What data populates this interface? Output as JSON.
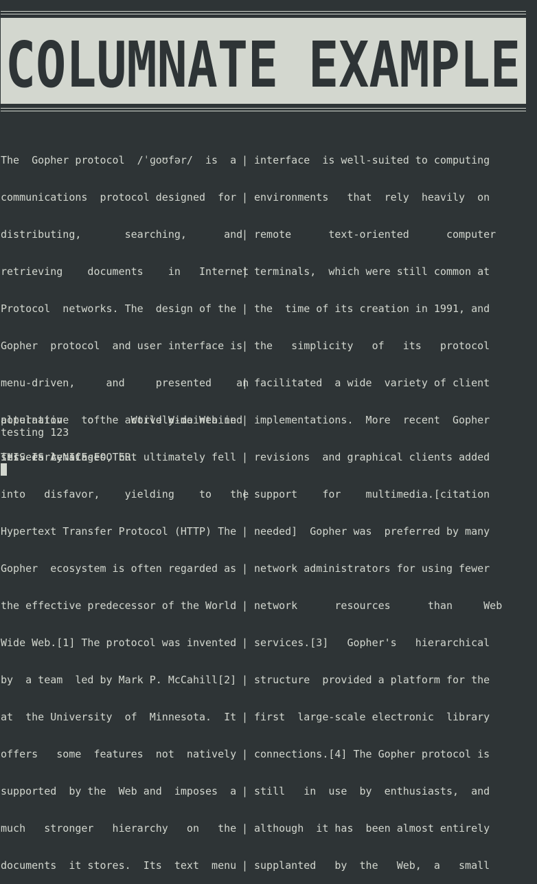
{
  "banner": {
    "title": "COLUMNATE EXAMPLE"
  },
  "columns": {
    "left": [
      "The  Gopher protocol  /ˈɡoʊfər/  is  a",
      "communications  protocol designed  for",
      "distributing,       searching,      and",
      "retrieving    documents    in   Internet",
      "Protocol  networks. The  design of the",
      "Gopher  protocol  and user interface is",
      "menu-driven,     and     presented    an",
      "alternative  to the  World Wide Web in",
      "its  early stages, but ultimately fell",
      "into   disfavor,    yielding    to   the",
      "Hypertext Transfer Protocol (HTTP) The",
      "Gopher  ecosystem is often regarded as",
      "the effective predecessor of the World",
      "Wide Web.[1] The protocol was invented",
      "by  a team  led by Mark P. McCahill[2]",
      "at  the University  of  Minnesota.  It",
      "offers   some  features  not  natively",
      "supported  by the  Web and  imposes  a",
      "much   stronger   hierarchy   on   the",
      "documents  it stores.  Its  text  menu"
    ],
    "separator": "|",
    "right": [
      "interface  is well-suited to computing",
      "environments   that  rely  heavily  on",
      "remote      text-oriented      computer",
      "terminals,  which were still common at",
      "the  time of its creation in 1991, and",
      "the   simplicity   of   its   protocol",
      "facilitated  a wide  variety of client",
      "implementations.  More  recent  Gopher",
      "revisions  and graphical clients added",
      "support    for    multimedia.[citation",
      "needed]  Gopher was  preferred by many",
      "network administrators for using fewer",
      "network      resources      than     Web",
      "services.[3]   Gopher's   hierarchical",
      "structure  provided a platform for the",
      "first  large-scale electronic  library",
      "connections.[4] The Gopher protocol is",
      "still   in  use  by  enthusiasts,  and",
      "although  it has  been almost entirely",
      "supplanted   by  the   Web,  a   small"
    ]
  },
  "continuation": [
    "population    of    actively-maintained",
    "servers remains."
  ],
  "test_line": "testing 123",
  "footer": "THIS IS A NICE FOOTER."
}
